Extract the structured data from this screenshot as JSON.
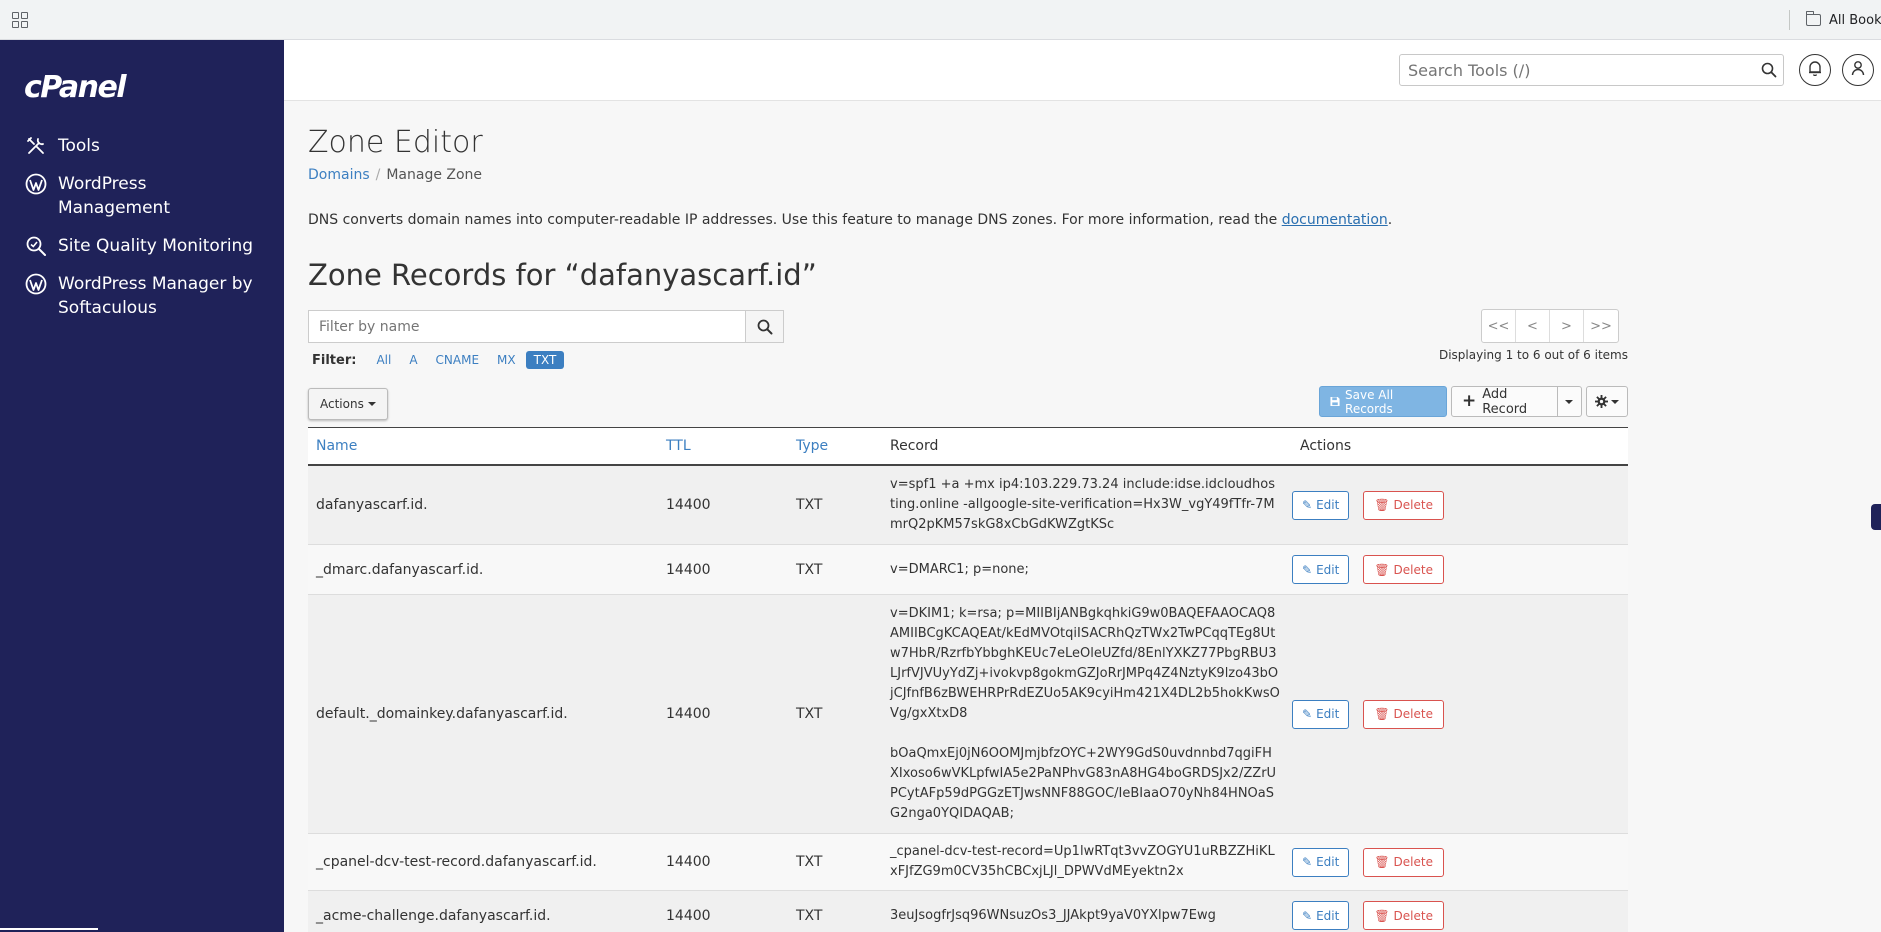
{
  "browser": {
    "bookmarks_label": "All Bookm"
  },
  "sidebar": {
    "logo": "cPanel",
    "items": [
      {
        "label": "Tools",
        "icon": "tools-icon"
      },
      {
        "label": "WordPress Management",
        "icon": "wordpress-icon"
      },
      {
        "label": "Site Quality Monitoring",
        "icon": "site-quality-icon"
      },
      {
        "label": "WordPress Manager by Softaculous",
        "icon": "wordpress-icon"
      }
    ]
  },
  "header": {
    "search_placeholder": "Search Tools (/)"
  },
  "page": {
    "title": "Zone Editor",
    "breadcrumb": [
      "Domains",
      "Manage Zone"
    ],
    "intro_text": "DNS converts domain names into computer-readable IP addresses. Use this feature to manage DNS zones. For more information, read the ",
    "intro_link": "documentation",
    "intro_end": ".",
    "zone_title": "Zone Records for “dafanyascarf.id”"
  },
  "filter": {
    "placeholder": "Filter by name",
    "label": "Filter:",
    "options": [
      "All",
      "A",
      "CNAME",
      "MX",
      "TXT"
    ],
    "active": "TXT"
  },
  "pager": {
    "buttons": [
      "<<",
      "<",
      ">",
      ">>"
    ],
    "displaying": "Displaying 1 to 6 out of 6 items"
  },
  "toolbar": {
    "actions_label": "Actions",
    "save_label": "Save All Records",
    "add_label": "Add Record"
  },
  "table": {
    "columns": [
      "Name",
      "TTL",
      "Type",
      "Record",
      "Actions"
    ],
    "edit_label": "Edit",
    "delete_label": "Delete",
    "rows": [
      {
        "name": "dafanyascarf.id.",
        "ttl": "14400",
        "type": "TXT",
        "record": "v=spf1 +a +mx ip4:103.229.73.24 include:idse.idcloudhosting.online -allgoogle-site-verification=Hx3W_vgY49fTfr-7MmrQ2pKM57skG8xCbGdKWZgtKSc",
        "record2": ""
      },
      {
        "name": "_dmarc.dafanyascarf.id.",
        "ttl": "14400",
        "type": "TXT",
        "record": "v=DMARC1; p=none;",
        "record2": ""
      },
      {
        "name": "default._domainkey.dafanyascarf.id.",
        "ttl": "14400",
        "type": "TXT",
        "record": "v=DKIM1; k=rsa; p=MIIBIjANBgkqhkiG9w0BAQEFAAOCAQ8AMIIBCgKCAQEAt/kEdMVOtqiISACRhQzTWx2TwPCqqTEg8Utw7HbR/RzrfbYbbghKEUc7eLeOleUZfd/8EnlYXKZ77PbgRBU3LJrfVJVUyYdZj+ivokvp8gokmGZJoRrJMPq4Z4NztyK9lzo43bOjCJfnfB6zBWEHRPrRdEZUo5AK9cyiHm421X4DL2b5hokKwsOVg/gxXtxD8",
        "record2": "bOaQmxEj0jN6OOMJmjbfzOYC+2WY9GdS0uvdnnbd7qgiFHXIxoso6wVKLpfwIA5e2PaNPhvG83nA8HG4boGRDSJx2/ZZrUPCytAFp59dPGGzETJwsNNF88GOC/IeBIaaO70yNh84HNOaSG2nga0YQIDAQAB;"
      },
      {
        "name": "_cpanel-dcv-test-record.dafanyascarf.id.",
        "ttl": "14400",
        "type": "TXT",
        "record": "_cpanel-dcv-test-record=Up1lwRTqt3vvZOGYU1uRBZZHiKLxFJfZG9m0CV35hCBCxjLJl_DPWVdMEyektn2x",
        "record2": ""
      },
      {
        "name": "_acme-challenge.dafanyascarf.id.",
        "ttl": "14400",
        "type": "TXT",
        "record": "3euJsogfrJsq96WNsuzOs3_JJAkpt9yaV0YXlpw7Ewg",
        "record2": ""
      }
    ]
  },
  "colors": {
    "sidebar_bg": "#1f2259",
    "link": "#3c7fc1",
    "danger": "#d9534f",
    "primary_light": "#7fb5e3"
  }
}
